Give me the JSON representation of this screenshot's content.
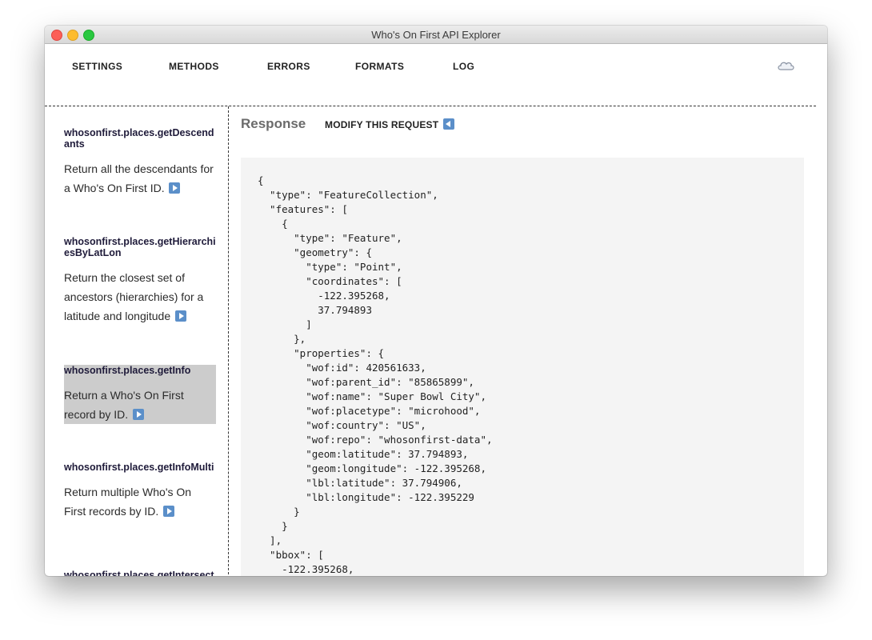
{
  "window": {
    "title": "Who's On First API Explorer"
  },
  "nav": {
    "items": [
      "SETTINGS",
      "METHODS",
      "ERRORS",
      "FORMATS",
      "LOG"
    ],
    "cloud_icon": "cloud-icon"
  },
  "sidebar": {
    "methods": [
      {
        "name": "whosonfirst.places.getDescendants",
        "description": "Return all the descendants for a Who's On First ID."
      },
      {
        "name": "whosonfirst.places.getHierarchiesByLatLon",
        "description": "Return the closest set of ancestors (hierarchies) for a latitude and longitude"
      },
      {
        "name": "whosonfirst.places.getInfo",
        "description": "Return a Who's On First record by ID.",
        "selected": true
      },
      {
        "name": "whosonfirst.places.getInfoMulti",
        "description": "Return multiple Who's On First records by ID."
      },
      {
        "name": "whosonfirst.places.getIntersects",
        "description": ""
      }
    ]
  },
  "response": {
    "title": "Response",
    "modify_label": "MODIFY THIS REQUEST",
    "json_text": "{\n  \"type\": \"FeatureCollection\",\n  \"features\": [\n    {\n      \"type\": \"Feature\",\n      \"geometry\": {\n        \"type\": \"Point\",\n        \"coordinates\": [\n          -122.395268,\n          37.794893\n        ]\n      },\n      \"properties\": {\n        \"wof:id\": 420561633,\n        \"wof:parent_id\": \"85865899\",\n        \"wof:name\": \"Super Bowl City\",\n        \"wof:placetype\": \"microhood\",\n        \"wof:country\": \"US\",\n        \"wof:repo\": \"whosonfirst-data\",\n        \"geom:latitude\": 37.794893,\n        \"geom:longitude\": -122.395268,\n        \"lbl:latitude\": 37.794906,\n        \"lbl:longitude\": -122.395229\n      }\n    }\n  ],\n  \"bbox\": [\n    -122.395268,"
  }
}
